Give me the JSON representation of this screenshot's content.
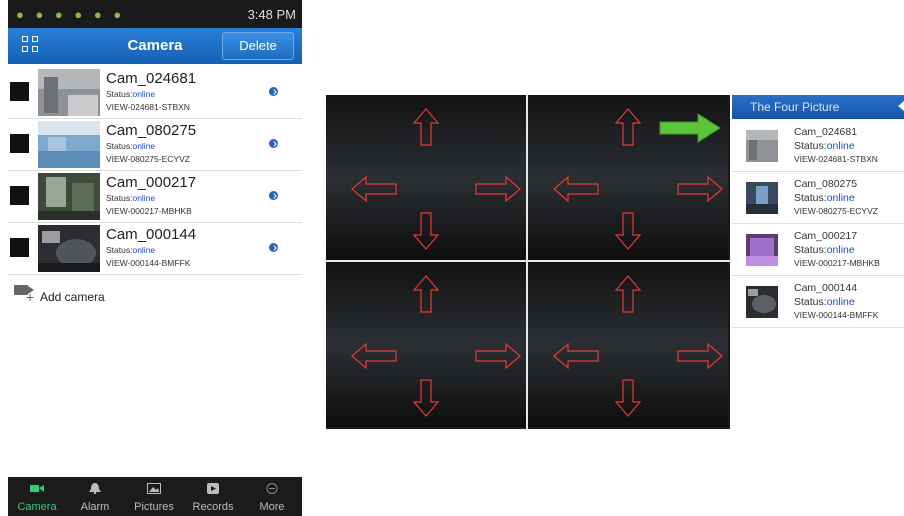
{
  "status_bar": {
    "time": "3:48 PM"
  },
  "header": {
    "title": "Camera",
    "delete_label": "Delete"
  },
  "cameras": [
    {
      "name": "Cam_024681",
      "status_label": "Status:",
      "status_value": "online",
      "view_id": "VIEW-024681-STBXN"
    },
    {
      "name": "Cam_080275",
      "status_label": "Status:",
      "status_value": "online",
      "view_id": "VIEW-080275-ECYVZ"
    },
    {
      "name": "Cam_000217",
      "status_label": "Status:",
      "status_value": "online",
      "view_id": "VIEW-000217-MBHKB"
    },
    {
      "name": "Cam_000144",
      "status_label": "Status:",
      "status_value": "online",
      "view_id": "VIEW-000144-BMFFK"
    }
  ],
  "add_camera_label": "Add camera",
  "bottom_nav": [
    {
      "label": "Camera",
      "icon": "video-camera-icon",
      "active": true
    },
    {
      "label": "Alarm",
      "icon": "bell-icon",
      "active": false
    },
    {
      "label": "Pictures",
      "icon": "picture-icon",
      "active": false
    },
    {
      "label": "Records",
      "icon": "play-record-icon",
      "active": false
    },
    {
      "label": "More",
      "icon": "more-circle-icon",
      "active": false
    }
  ],
  "side_panel": {
    "title": "The Four Picture",
    "cameras": [
      {
        "name": "Cam_024681",
        "status_label": "Status:",
        "status_value": "online",
        "view_id": "VIEW-024681-STBXN"
      },
      {
        "name": "Cam_080275",
        "status_label": "Status:",
        "status_value": "online",
        "view_id": "VIEW-080275-ECYVZ"
      },
      {
        "name": "Cam_000217",
        "status_label": "Status:",
        "status_value": "online",
        "view_id": "VIEW-000217-MBHKB"
      },
      {
        "name": "Cam_000144",
        "status_label": "Status:",
        "status_value": "online",
        "view_id": "VIEW-000144-BMFFK"
      }
    ]
  },
  "colors": {
    "accent_blue": "#1660b4",
    "online_blue": "#1a4fd0",
    "nav_active": "#2fd07a",
    "arrow_red": "#e53935",
    "arrow_green": "#5cc53a"
  }
}
